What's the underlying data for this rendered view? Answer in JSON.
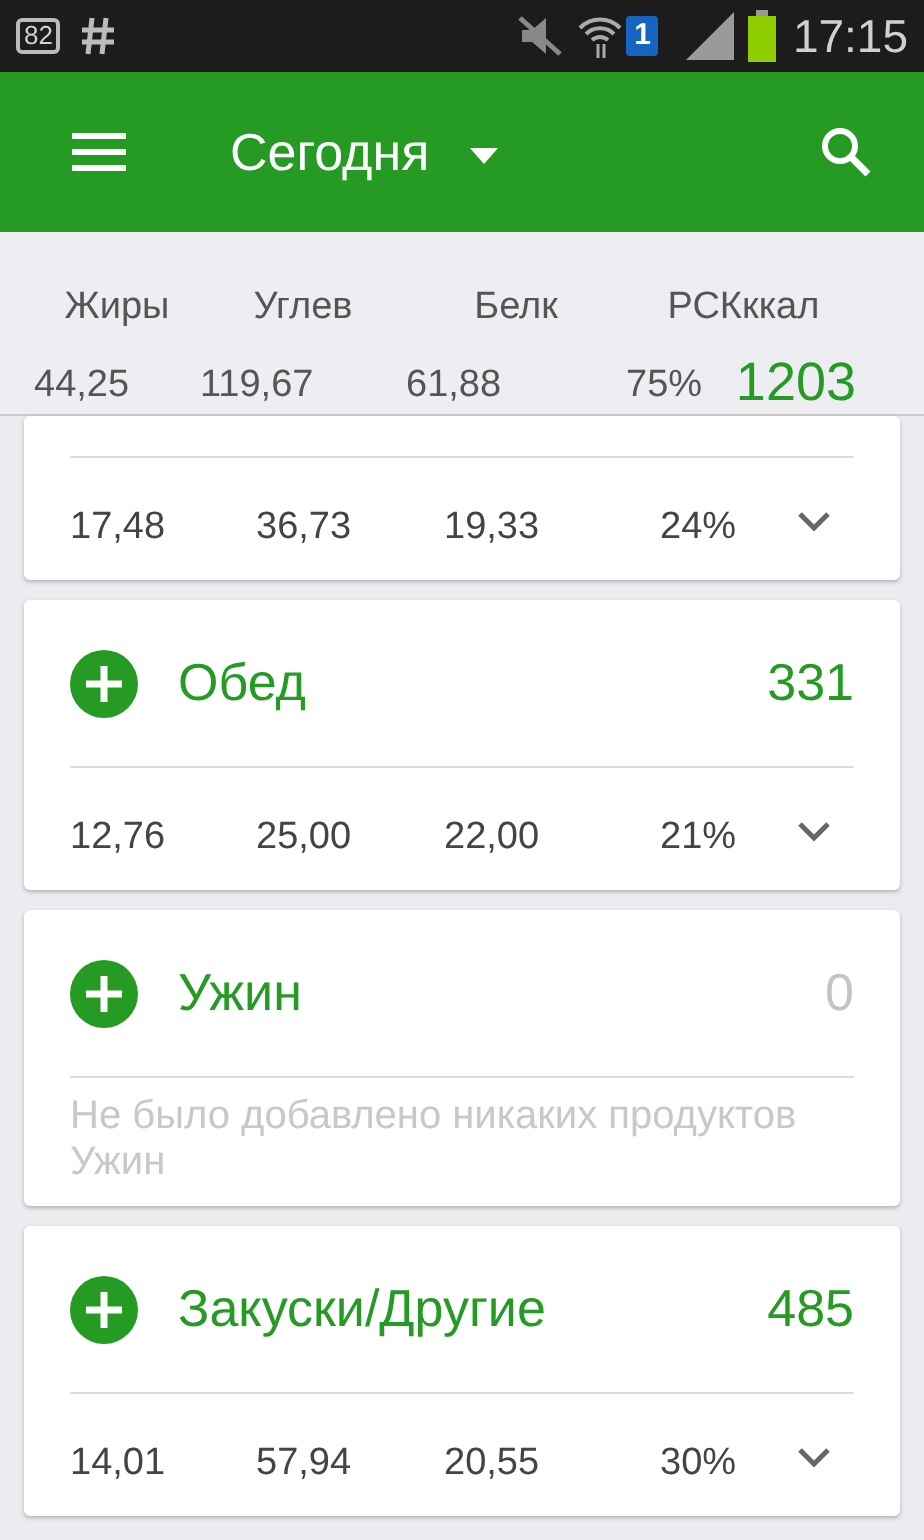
{
  "status_bar": {
    "notification_count": "82",
    "sim": "1",
    "time": "17:15"
  },
  "toolbar": {
    "title": "Сегодня"
  },
  "summary": {
    "columns": [
      {
        "label": "Жиры",
        "value": "44,25"
      },
      {
        "label": "Углев",
        "value": "119,67"
      },
      {
        "label": "Белк",
        "value": "61,88"
      },
      {
        "label": "РСК",
        "value": "75%"
      }
    ],
    "energy_label": "ккал",
    "energy_value": "1203"
  },
  "meals": [
    {
      "kind": "macros",
      "cut": true,
      "values": [
        "17,48",
        "36,73",
        "19,33",
        "24%"
      ]
    },
    {
      "kind": "macros",
      "name": "Обед",
      "calories": "331",
      "values": [
        "12,76",
        "25,00",
        "22,00",
        "21%"
      ]
    },
    {
      "kind": "empty",
      "name": "Ужин",
      "calories": "0",
      "message": "Не было добавлено никаких продуктов Ужин"
    },
    {
      "kind": "macros",
      "name": "Закуски/Другие",
      "calories": "485",
      "values": [
        "14,01",
        "57,94",
        "20,55",
        "30%"
      ]
    }
  ]
}
